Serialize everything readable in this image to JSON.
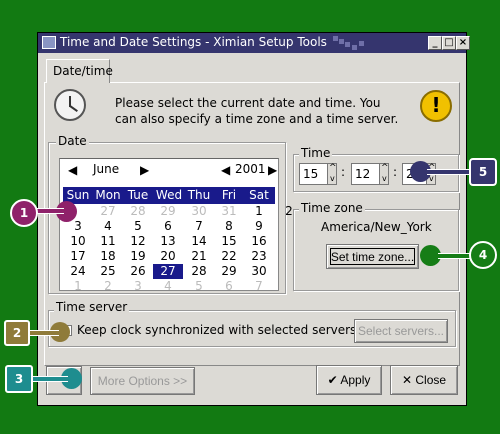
{
  "window": {
    "title": "Time and Date Settings - Ximian Setup Tools",
    "controls": [
      "minimize-icon",
      "maximize-icon",
      "close-icon"
    ],
    "controls_glyphs": [
      "_",
      "□",
      "×"
    ]
  },
  "tabs": [
    {
      "label": "Date/time",
      "selected": true
    }
  ],
  "intro": "Please select the current date and time. You can also specify a time zone and a time server.",
  "date": {
    "label": "Date",
    "month": "June",
    "year": "2001",
    "weekdays": [
      "Sun",
      "Mon",
      "Tue",
      "Wed",
      "Thu",
      "Fri",
      "Sat"
    ],
    "weeks": [
      [
        "27",
        "28",
        "29",
        "30",
        "31",
        "1",
        "2"
      ],
      [
        "3",
        "4",
        "5",
        "6",
        "7",
        "8",
        "9"
      ],
      [
        "10",
        "11",
        "12",
        "13",
        "14",
        "15",
        "16"
      ],
      [
        "17",
        "18",
        "19",
        "20",
        "21",
        "22",
        "23"
      ],
      [
        "24",
        "25",
        "26",
        "27",
        "28",
        "29",
        "30"
      ],
      [
        "1",
        "2",
        "3",
        "4",
        "5",
        "6",
        "7"
      ]
    ],
    "selected_day": "27"
  },
  "time": {
    "label": "Time",
    "hour": "15",
    "minute": "12",
    "second": "2",
    "separator": ":"
  },
  "timezone": {
    "label": "Time zone",
    "value": "America/New_York",
    "button": "Set time zone..."
  },
  "time_server": {
    "label": "Time server",
    "checkbox": "Keep clock synchronized with selected servers",
    "button": "Select servers..."
  },
  "footer": {
    "more_options": "More Options >>",
    "apply": "Apply",
    "close": "Close",
    "apply_glyph": "✔",
    "close_glyph": "✕"
  },
  "callouts": [
    {
      "number": "1",
      "color": "#8f216a"
    },
    {
      "number": "2",
      "color": "#8f7b3a"
    },
    {
      "number": "3",
      "color": "#1e8d8f"
    },
    {
      "number": "4",
      "color": "#167d16"
    },
    {
      "number": "5",
      "color": "#35356e"
    }
  ],
  "colors": {
    "desktop": "#127a12",
    "titlebar": "#35356e",
    "selection": "#191a8b",
    "window": "#dcdad5"
  }
}
